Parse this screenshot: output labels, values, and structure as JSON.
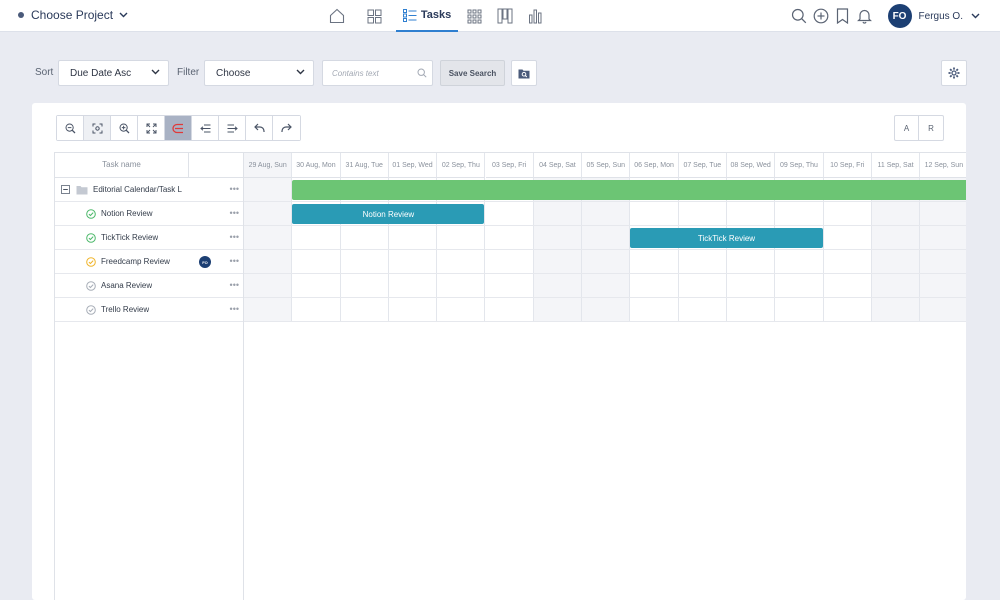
{
  "topnav": {
    "project_label": "Choose Project",
    "tasks_label": "Tasks",
    "user_initials": "FO",
    "user_name": "Fergus O."
  },
  "filters": {
    "sort_label": "Sort",
    "sort_value": "Due Date Asc",
    "filter_label": "Filter",
    "filter_value": "Choose",
    "search_placeholder": "Contains text",
    "save_search_label": "Save Search"
  },
  "toggle": {
    "a": "A",
    "r": "R"
  },
  "task_list": {
    "header": "Task name",
    "rows": [
      {
        "name": "Editorial Calendar/Task L",
        "type": "group"
      },
      {
        "name": "Notion Review",
        "status": "done"
      },
      {
        "name": "TickTick Review",
        "status": "done"
      },
      {
        "name": "Freedcamp Review",
        "status": "in-progress",
        "assignee": "FO"
      },
      {
        "name": "Asana Review",
        "status": "open"
      },
      {
        "name": "Trello Review",
        "status": "open"
      }
    ]
  },
  "timeline": {
    "days": [
      {
        "label": "29 Aug, Sun",
        "weekend": true
      },
      {
        "label": "30 Aug, Mon",
        "weekend": false
      },
      {
        "label": "31 Aug, Tue",
        "weekend": false
      },
      {
        "label": "01 Sep, Wed",
        "weekend": false
      },
      {
        "label": "02 Sep, Thu",
        "weekend": false
      },
      {
        "label": "03 Sep, Fri",
        "weekend": false
      },
      {
        "label": "04 Sep, Sat",
        "weekend": true
      },
      {
        "label": "05 Sep, Sun",
        "weekend": true
      },
      {
        "label": "06 Sep, Mon",
        "weekend": false
      },
      {
        "label": "07 Sep, Tue",
        "weekend": false
      },
      {
        "label": "08 Sep, Wed",
        "weekend": false
      },
      {
        "label": "09 Sep, Thu",
        "weekend": false
      },
      {
        "label": "10 Sep, Fri",
        "weekend": false
      },
      {
        "label": "11 Sep, Sat",
        "weekend": true
      },
      {
        "label": "12 Sep, Sun",
        "weekend": true
      }
    ],
    "bars": [
      {
        "row": 0,
        "start": "30 Aug, Mon",
        "end": "12 Sep, Sun",
        "label": "",
        "color": "#6cc574"
      },
      {
        "row": 1,
        "start": "30 Aug, Mon",
        "end": "02 Sep, Thu",
        "label": "Notion Review",
        "color": "#2a9bb5"
      },
      {
        "row": 2,
        "start": "06 Sep, Mon",
        "end": "09 Sep, Thu",
        "label": "TickTick Review",
        "color": "#2a9bb5"
      }
    ]
  },
  "colors": {
    "accent": "#2f7fd0",
    "done": "#4cb86a",
    "in_progress": "#f0b429",
    "open": "#a7adb7"
  }
}
